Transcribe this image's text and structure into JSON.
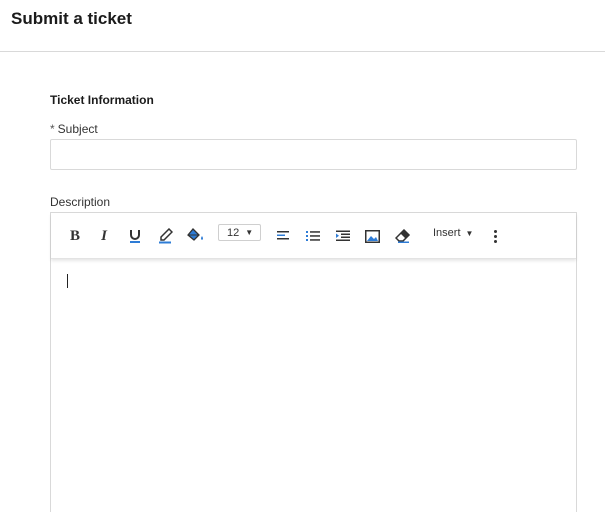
{
  "header": {
    "title": "Submit a ticket"
  },
  "form": {
    "section_title": "Ticket Information",
    "subject": {
      "required_marker": "*",
      "label": "Subject",
      "value": ""
    },
    "description": {
      "label": "Description",
      "value": ""
    }
  },
  "toolbar": {
    "bold_label": "B",
    "italic_label": "I",
    "font_size": "12",
    "insert_label": "Insert",
    "icons": [
      "bold-icon",
      "italic-icon",
      "underline-icon",
      "text-color-icon",
      "background-color-icon",
      "font-size-dropdown",
      "align-left-icon",
      "bulleted-list-icon",
      "indent-icon",
      "image-icon",
      "clear-formatting-icon",
      "insert-dropdown",
      "more-options-icon"
    ],
    "accent_color": "#2e7cd6"
  }
}
